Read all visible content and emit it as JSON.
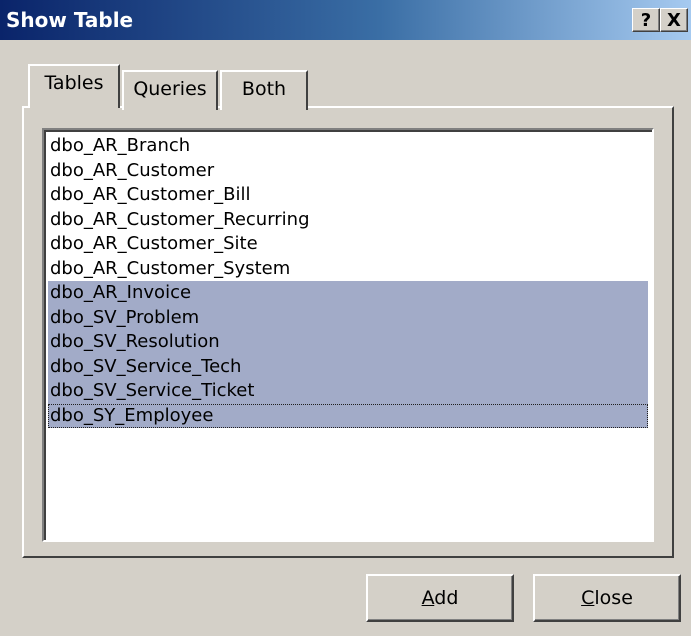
{
  "window": {
    "title": "Show Table",
    "help_button": "?",
    "close_button": "X"
  },
  "tabs": [
    {
      "label": "Tables",
      "active": true
    },
    {
      "label": "Queries",
      "active": false
    },
    {
      "label": "Both",
      "active": false
    }
  ],
  "table_list": [
    {
      "name": "dbo_AR_Branch",
      "selected": false
    },
    {
      "name": "dbo_AR_Customer",
      "selected": false
    },
    {
      "name": "dbo_AR_Customer_Bill",
      "selected": false
    },
    {
      "name": "dbo_AR_Customer_Recurring",
      "selected": false
    },
    {
      "name": "dbo_AR_Customer_Site",
      "selected": false
    },
    {
      "name": "dbo_AR_Customer_System",
      "selected": false
    },
    {
      "name": "dbo_AR_Invoice",
      "selected": true
    },
    {
      "name": "dbo_SV_Problem",
      "selected": true
    },
    {
      "name": "dbo_SV_Resolution",
      "selected": true
    },
    {
      "name": "dbo_SV_Service_Tech",
      "selected": true
    },
    {
      "name": "dbo_SV_Service_Ticket",
      "selected": true
    },
    {
      "name": "dbo_SY_Employee",
      "selected": true,
      "focused": true
    }
  ],
  "buttons": {
    "add": {
      "accel": "A",
      "rest": "dd"
    },
    "close": {
      "accel": "C",
      "rest": "lose"
    }
  },
  "colors": {
    "title_bar_start": "#0a246a",
    "title_bar_end": "#a6caf0",
    "dialog_face": "#d4d0c8",
    "selection": "#a2abc8"
  }
}
